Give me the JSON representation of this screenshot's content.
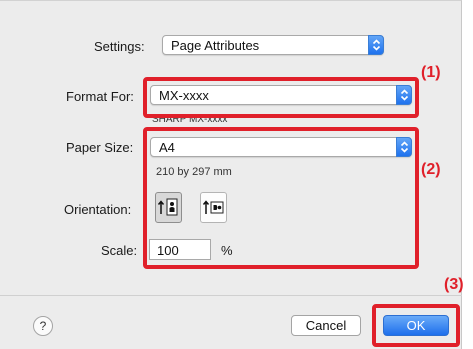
{
  "settings": {
    "label": "Settings:",
    "value": "Page Attributes"
  },
  "format_for": {
    "label": "Format For:",
    "value": "MX-xxxx",
    "sub": "SHARP MX-xxxx"
  },
  "paper_size": {
    "label": "Paper Size:",
    "value": "A4",
    "dimensions": "210 by 297 mm"
  },
  "orientation": {
    "label": "Orientation:",
    "selected": "portrait"
  },
  "scale": {
    "label": "Scale:",
    "value": "100",
    "unit": "%"
  },
  "buttons": {
    "help": "?",
    "cancel": "Cancel",
    "ok": "OK"
  },
  "callouts": {
    "one": "(1)",
    "two": "(2)",
    "three": "(3)"
  },
  "colors": {
    "callout_red": "#e0202a",
    "accent_blue": "#1f72ee",
    "dialog_bg": "#ececec"
  }
}
